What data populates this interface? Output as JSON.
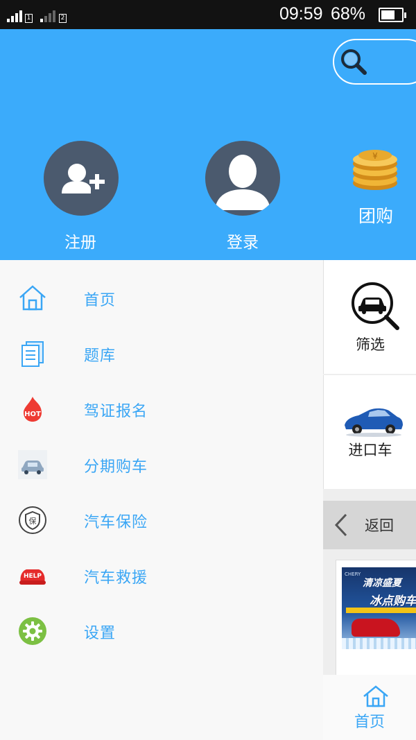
{
  "status_bar": {
    "sim1": "1",
    "sim2": "2",
    "time": "09:59",
    "battery_percent": "68%",
    "battery_level": 0.68
  },
  "header": {
    "search_icon": "search-icon",
    "register_label": "注册",
    "login_label": "登录",
    "groupbuy_label": "团购",
    "background_color": "#3babfb"
  },
  "right_panel": {
    "filter_label": "筛选",
    "import_car_label": "进口车",
    "back_label": "返回",
    "banner": {
      "brand": "CHERY",
      "line1": "清凉盛夏",
      "line2": "冰点购车"
    },
    "tab_home_label": "首页"
  },
  "menu": {
    "accent_color": "#3aa6f5",
    "items": [
      {
        "label": "首页",
        "icon": "home-icon"
      },
      {
        "label": "题库",
        "icon": "document-icon"
      },
      {
        "label": "驾证报名",
        "icon": "hot-flame-icon",
        "badge": "HOT"
      },
      {
        "label": "分期购车",
        "icon": "car-icon"
      },
      {
        "label": "汽车保险",
        "icon": "insurance-shield-icon",
        "badge": "保"
      },
      {
        "label": "汽车救援",
        "icon": "help-car-icon",
        "badge": "HELP"
      },
      {
        "label": "设置",
        "icon": "settings-gear-icon"
      }
    ]
  }
}
